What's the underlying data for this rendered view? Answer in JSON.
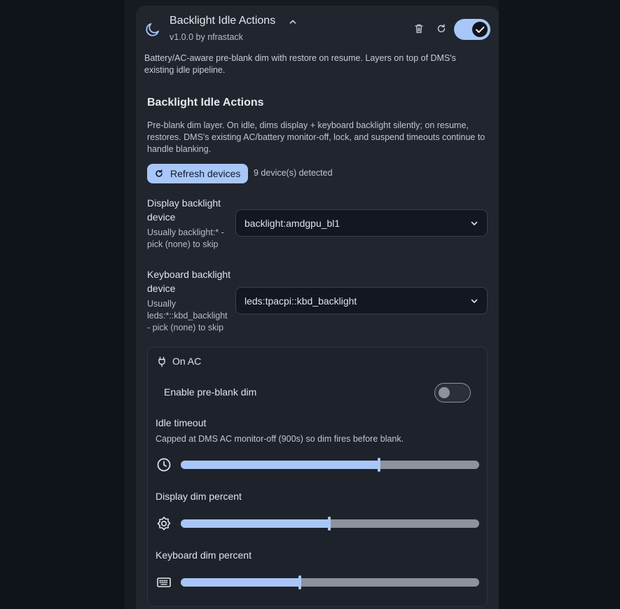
{
  "plugin": {
    "title": "Backlight Idle Actions",
    "subtitle": "v1.0.0 by nfrastack",
    "description": "Battery/AC-aware pre-blank dim with restore on resume. Layers on top of DMS's existing idle pipeline.",
    "enabled": true,
    "icon": "moon-icon"
  },
  "settings": {
    "title": "Backlight Idle Actions",
    "description": "Pre-blank dim layer. On idle, dims display + keyboard backlight silently; on resume, restores. DMS's existing AC/battery monitor-off, lock, and suspend timeouts continue to handle blanking.",
    "refresh_label": "Refresh devices",
    "detected": "9 device(s) detected"
  },
  "display_device": {
    "label": "Display backlight device",
    "hint": "Usually backlight:* - pick (none) to skip",
    "value": "backlight:amdgpu_bl1"
  },
  "keyboard_device": {
    "label": "Keyboard backlight device",
    "hint": "Usually leds:*::kbd_backlight - pick (none) to skip",
    "value": "leds:tpacpi::kbd_backlight"
  },
  "on_ac": {
    "label": "On AC",
    "enable_label": "Enable pre-blank dim",
    "enable_value": false,
    "idle_timeout": {
      "label": "Idle timeout",
      "description": "Capped at DMS AC monitor-off (900s) so dim fires before blank.",
      "fraction": 0.665
    },
    "display_dim": {
      "label": "Display dim percent",
      "fraction": 0.497
    },
    "keyboard_dim": {
      "label": "Keyboard dim percent",
      "fraction": 0.399
    }
  },
  "colors": {
    "accent": "#a9c6f8",
    "background": "#0f141b",
    "card": "#20252e"
  }
}
